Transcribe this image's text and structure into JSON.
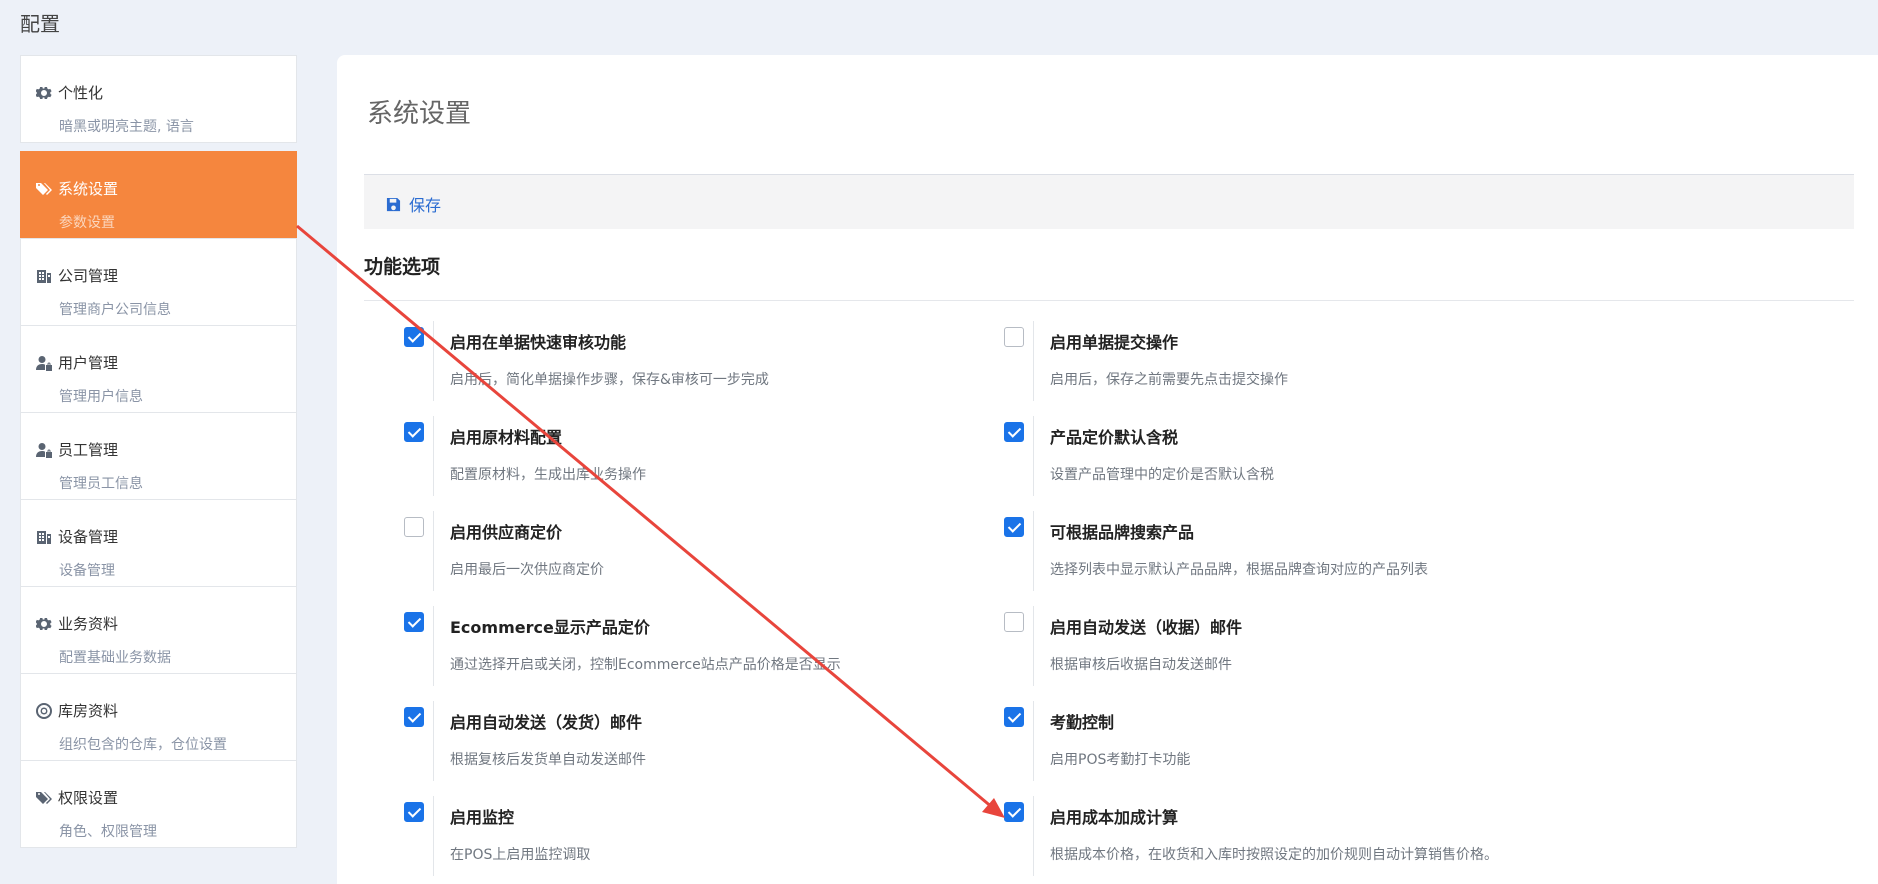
{
  "page_title": "配置",
  "sidebar": {
    "items": [
      {
        "label": "个性化",
        "sub": "暗黑或明亮主题, 语言",
        "icon": "gear-icon"
      },
      {
        "label": "系统设置",
        "sub": "参数设置",
        "icon": "tags-icon",
        "active": true
      },
      {
        "label": "公司管理",
        "sub": "管理商户公司信息",
        "icon": "building-icon"
      },
      {
        "label": "用户管理",
        "sub": "管理用户信息",
        "icon": "user-lock-icon"
      },
      {
        "label": "员工管理",
        "sub": "管理员工信息",
        "icon": "user-lock-icon"
      },
      {
        "label": "设备管理",
        "sub": "设备管理",
        "icon": "building-icon"
      },
      {
        "label": "业务资料",
        "sub": "配置基础业务数据",
        "icon": "gear-icon"
      },
      {
        "label": "库房资料",
        "sub": "组织包含的仓库，仓位设置",
        "icon": "lifebuoy-icon"
      },
      {
        "label": "权限设置",
        "sub": "角色、权限管理",
        "icon": "tags-icon"
      }
    ]
  },
  "main": {
    "title": "系统设置",
    "save_label": "保存",
    "section_title": "功能选项",
    "options_left": [
      {
        "label": "启用在单据快速审核功能",
        "desc": "启用后，简化单据操作步骤，保存&审核可一步完成",
        "checked": true
      },
      {
        "label": "启用原材料配置",
        "desc": "配置原材料，生成出库业务操作",
        "checked": true
      },
      {
        "label": "启用供应商定价",
        "desc": "启用最后一次供应商定价",
        "checked": false
      },
      {
        "label": "Ecommerce显示产品定价",
        "desc": "通过选择开启或关闭，控制Ecommerce站点产品价格是否显示",
        "checked": true
      },
      {
        "label": "启用自动发送（发货）邮件",
        "desc": "根据复核后发货单自动发送邮件",
        "checked": true
      },
      {
        "label": "启用监控",
        "desc": "在POS上启用监控调取",
        "checked": true
      }
    ],
    "options_right": [
      {
        "label": "启用单据提交操作",
        "desc": "启用后，保存之前需要先点击提交操作",
        "checked": false
      },
      {
        "label": "产品定价默认含税",
        "desc": "设置产品管理中的定价是否默认含税",
        "checked": true
      },
      {
        "label": "可根据品牌搜索产品",
        "desc": "选择列表中显示默认产品品牌，根据品牌查询对应的产品列表",
        "checked": true
      },
      {
        "label": "启用自动发送（收据）邮件",
        "desc": "根据审核后收据自动发送邮件",
        "checked": false
      },
      {
        "label": "考勤控制",
        "desc": "启用POS考勤打卡功能",
        "checked": true
      },
      {
        "label": "启用成本加成计算",
        "desc": "根据成本价格，在收货和入库时按照设定的加价规则自动计算销售价格。",
        "checked": true
      }
    ]
  },
  "colors": {
    "accent": "#f5863e",
    "checkbox": "#1a73e8",
    "link": "#2b6cd1",
    "annotation_arrow": "#e8453c"
  }
}
